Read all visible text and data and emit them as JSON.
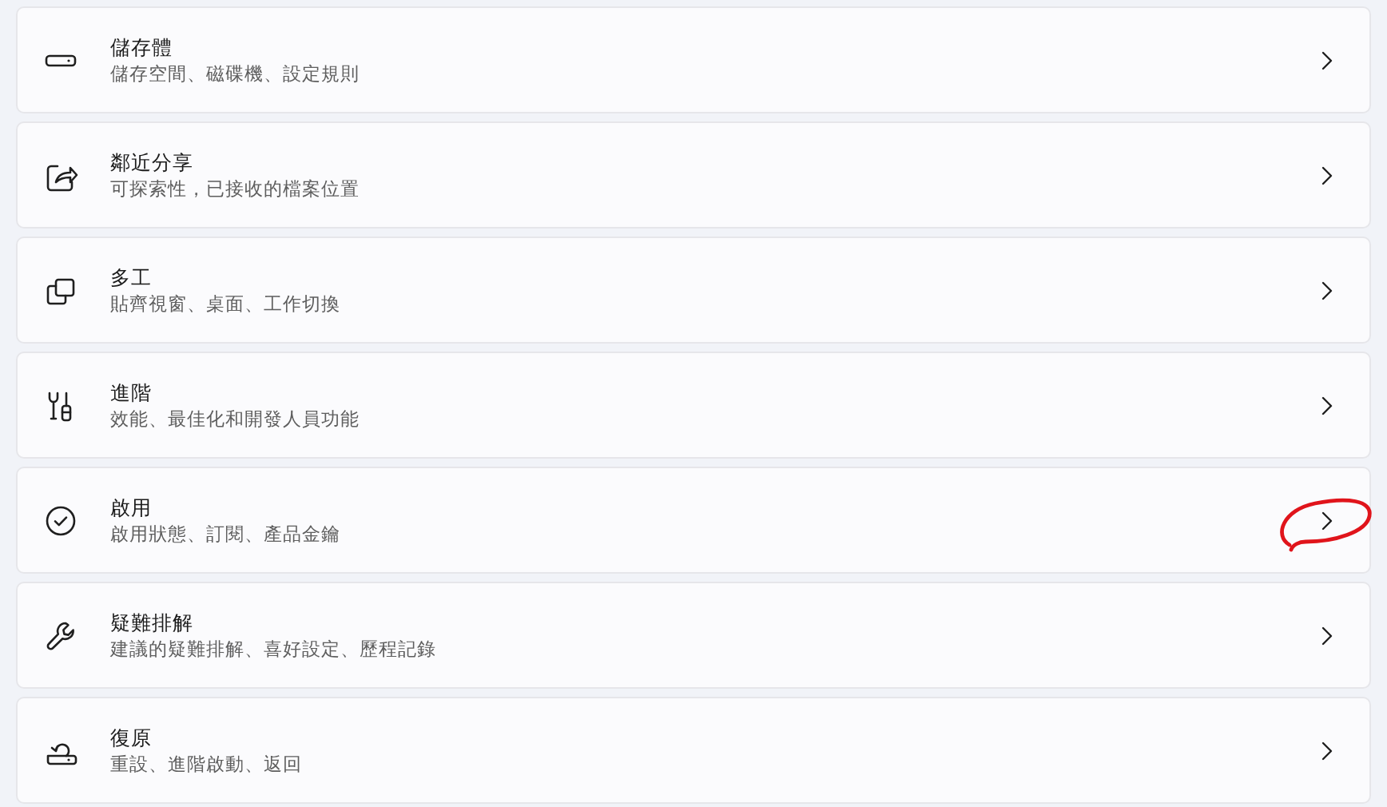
{
  "items": [
    {
      "title": "儲存體",
      "subtitle": "儲存空間、磁碟機、設定規則",
      "circled": false
    },
    {
      "title": "鄰近分享",
      "subtitle": "可探索性，已接收的檔案位置",
      "circled": false
    },
    {
      "title": "多工",
      "subtitle": "貼齊視窗、桌面、工作切換",
      "circled": false
    },
    {
      "title": "進階",
      "subtitle": "效能、最佳化和開發人員功能",
      "circled": false
    },
    {
      "title": "啟用",
      "subtitle": "啟用狀態、訂閱、產品金鑰",
      "circled": true
    },
    {
      "title": "疑難排解",
      "subtitle": "建議的疑難排解、喜好設定、歷程記錄",
      "circled": false
    },
    {
      "title": "復原",
      "subtitle": "重設、進階啟動、返回",
      "circled": false
    }
  ]
}
